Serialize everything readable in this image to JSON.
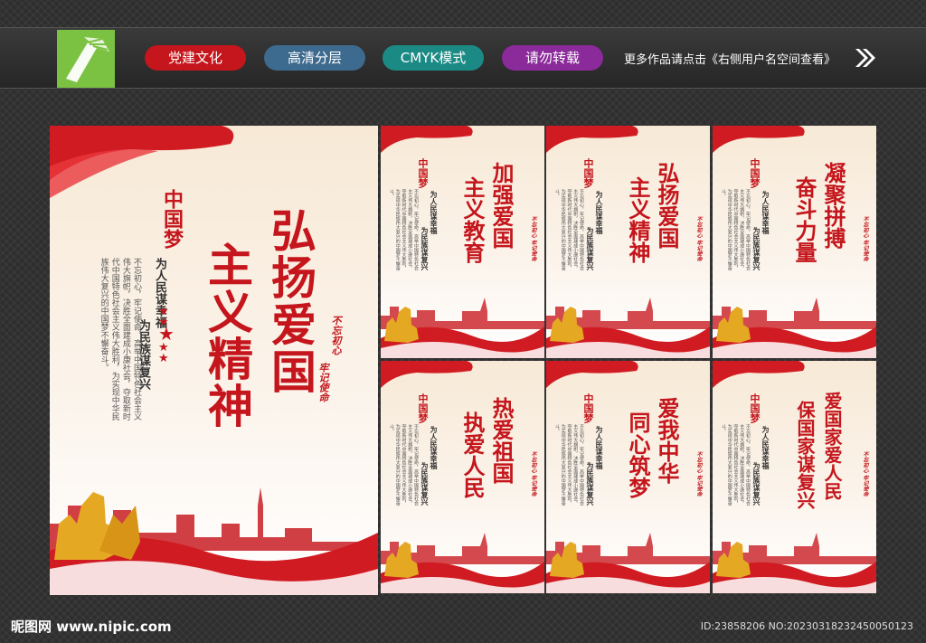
{
  "header": {
    "tags": [
      {
        "label": "党建文化",
        "color": "#c4161c"
      },
      {
        "label": "高清分层",
        "color": "#3d6a8f"
      },
      {
        "label": "CMYK模式",
        "color": "#1c8a84"
      },
      {
        "label": "请勿转载",
        "color": "#8b2a9a"
      }
    ],
    "note": "更多作品请点击《右侧用户名空间查看》"
  },
  "main_poster": {
    "title_col1": "弘扬爱国",
    "title_col2": "主义精神",
    "slogan_col1": "为人民谋幸福",
    "slogan_col2": "为民族谋复兴",
    "seal_col1": "不忘初心",
    "seal_col2": "牢记使命",
    "body": "不忘初心，牢记使命，高举中国特色社会主义伟大旗帜，决胜全面建成小康社会，夺取新时代中国特色社会主义伟大胜利，为实现中华民族伟大复兴的中国梦不懈奋斗。",
    "logo_text": "中国梦"
  },
  "small_posters": [
    {
      "title_col1": "加强爱国",
      "title_col2": "主义教育"
    },
    {
      "title_col1": "弘扬爱国",
      "title_col2": "主义精神"
    },
    {
      "title_col1": "凝聚拼搏",
      "title_col2": "奋斗力量"
    },
    {
      "title_col1": "热爱祖国",
      "title_col2": "执爱人民"
    },
    {
      "title_col1": "爱我中华",
      "title_col2": "同心筑梦"
    },
    {
      "title_col1": "爱国家爱人民",
      "title_col2": "保国家谋复兴"
    }
  ],
  "small_common": {
    "slogan_col1": "为人民谋幸福",
    "slogan_col2": "为民族谋复兴",
    "seal": "不忘初心 牢记使命"
  },
  "footer": {
    "site": "昵图网 www.nipic.com",
    "id": "ID:23858206 NO:20230318232450050123"
  }
}
